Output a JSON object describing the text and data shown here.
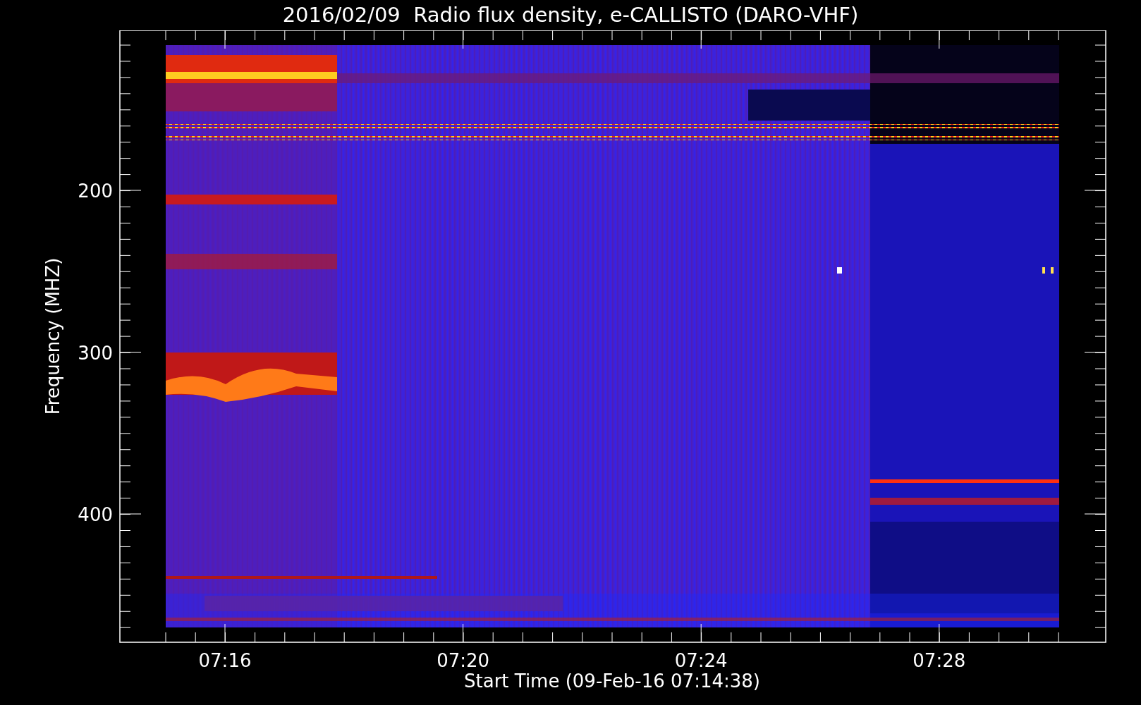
{
  "title": "2016/02/09  Radio flux density, e-CALLISTO (DARO-VHF)",
  "y_axis": {
    "label": "Frequency (MHZ)",
    "ticks": [
      "200",
      "300",
      "400"
    ]
  },
  "x_axis": {
    "label": "Start Time (09-Feb-16 07:14:38)",
    "ticks": [
      "07:16",
      "07:20",
      "07:24",
      "07:28"
    ]
  }
}
